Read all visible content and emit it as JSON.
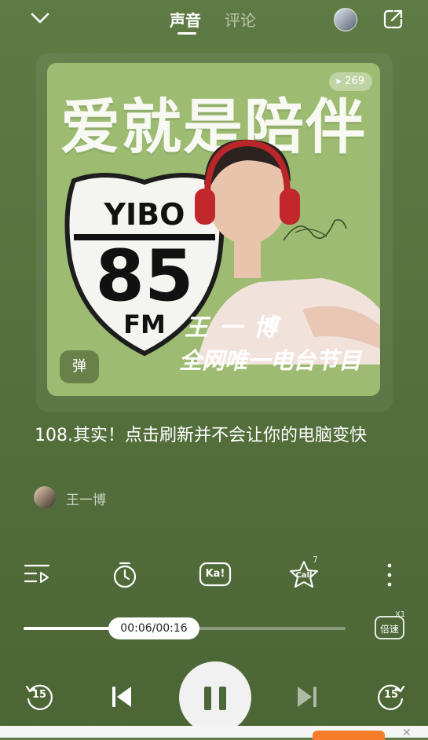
{
  "header": {
    "tabs": [
      {
        "label": "声音",
        "active": true
      },
      {
        "label": "评论",
        "active": false
      }
    ]
  },
  "cover": {
    "title": "爱就是陪伴",
    "play_count": "269",
    "shield_top": "YIBO",
    "shield_number": "85",
    "shield_bottom": "FM",
    "subtitle_name": "王一博",
    "subtitle_program": "全网唯一电台节目",
    "badge": "弹",
    "colors": {
      "bg": "#9dbc72",
      "headphones": "#c0282b"
    }
  },
  "track": {
    "title": "108.其实！点击刷新并不会让你的电脑变快",
    "author": "王一博"
  },
  "controls": {
    "ka_label": "Ka!",
    "call_label": "Call",
    "call_count": "7",
    "speed_label": "倍速",
    "speed_value": "X1"
  },
  "progress": {
    "time": "00:06/00:16",
    "fraction": 0.375
  },
  "playback": {
    "rewind": "15",
    "forward": "15"
  }
}
